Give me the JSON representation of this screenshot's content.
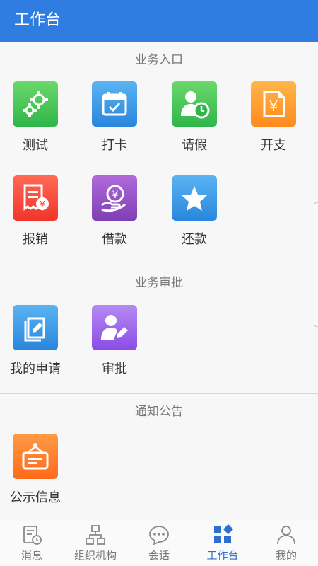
{
  "header": {
    "title": "工作台"
  },
  "colors": {
    "accent": "#2f7de1",
    "tab_active": "#2f6fd1"
  },
  "sections": {
    "business": {
      "title": "业务入口",
      "items": [
        {
          "label": "测试",
          "icon": "gears-icon"
        },
        {
          "label": "打卡",
          "icon": "calendar-check-icon"
        },
        {
          "label": "请假",
          "icon": "user-clock-icon"
        },
        {
          "label": "开支",
          "icon": "yuan-document-icon"
        },
        {
          "label": "报销",
          "icon": "receipt-yuan-icon"
        },
        {
          "label": "借款",
          "icon": "hand-yuan-icon"
        },
        {
          "label": "还款",
          "icon": "star-icon"
        }
      ]
    },
    "approval": {
      "title": "业务审批",
      "items": [
        {
          "label": "我的申请",
          "icon": "edit-document-icon"
        },
        {
          "label": "审批",
          "icon": "user-pen-icon"
        }
      ]
    },
    "notice": {
      "title": "通知公告",
      "items": [
        {
          "label": "公示信息",
          "icon": "notice-board-icon"
        }
      ]
    }
  },
  "tabbar": {
    "items": [
      {
        "label": "消息",
        "icon": "message-clock-icon"
      },
      {
        "label": "组织机构",
        "icon": "org-chart-icon"
      },
      {
        "label": "会话",
        "icon": "chat-bubble-icon"
      },
      {
        "label": "工作台",
        "icon": "grid-icon",
        "active": true
      },
      {
        "label": "我的",
        "icon": "person-icon"
      }
    ]
  }
}
